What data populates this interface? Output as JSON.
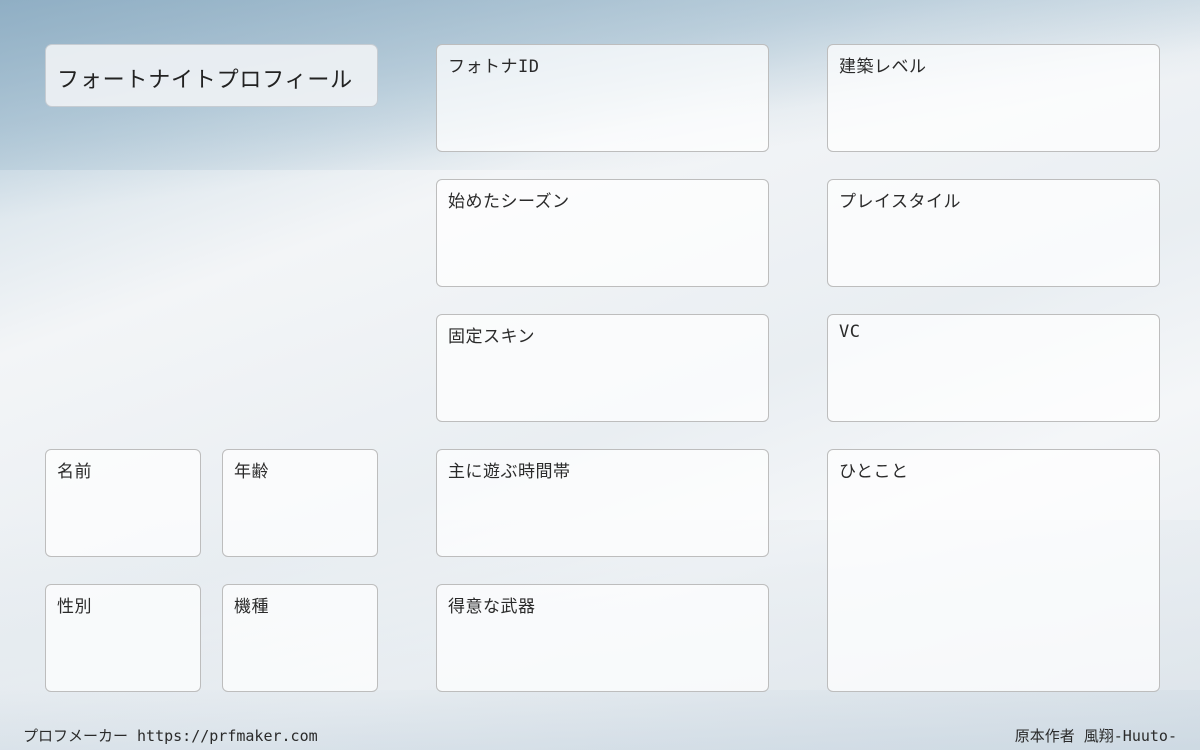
{
  "title": "フォートナイトプロフィール",
  "fields": {
    "fortnite_id": "フォトナID",
    "build_level": "建築レベル",
    "start_season": "始めたシーズン",
    "play_style": "プレイスタイル",
    "fixed_skin": "固定スキン",
    "vc": "VC",
    "play_time": "主に遊ぶ時間帯",
    "comment": "ひとこと",
    "favorite_weapon": "得意な武器",
    "name": "名前",
    "age": "年齢",
    "gender": "性別",
    "platform": "機種"
  },
  "footer": {
    "maker": "プロフメーカー https://prfmaker.com",
    "author": "原本作者 風翔-Huuto-"
  }
}
